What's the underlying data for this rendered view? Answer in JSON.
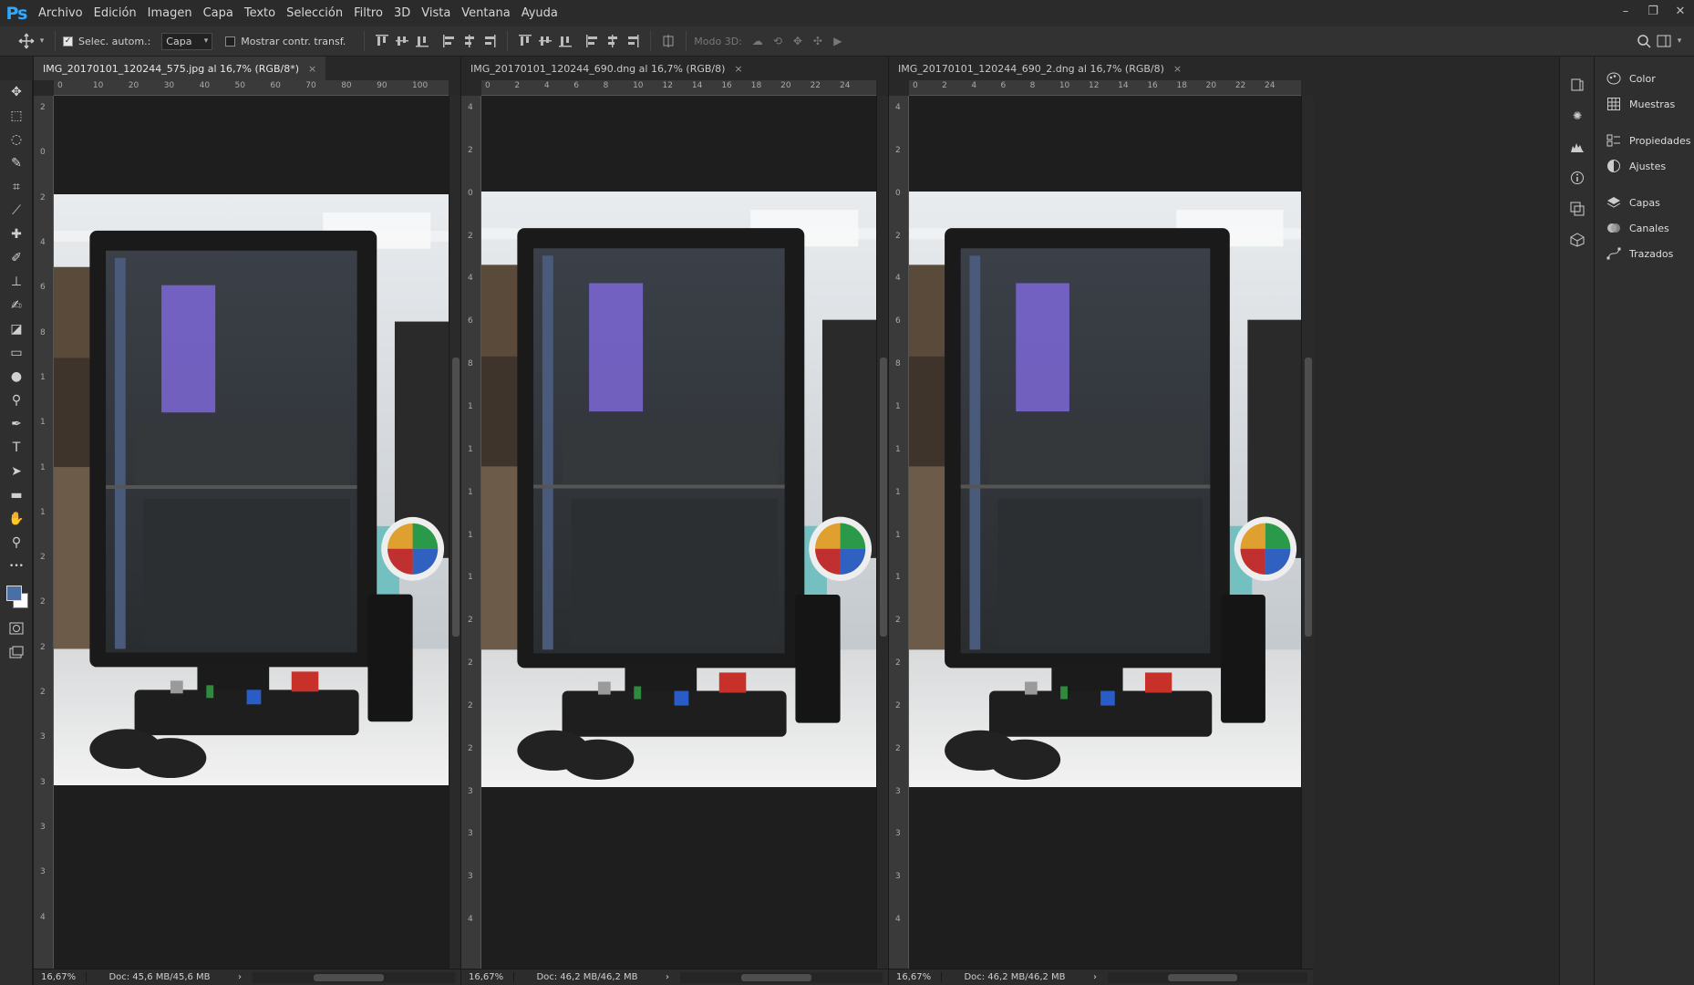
{
  "app": {
    "logo": "Ps"
  },
  "menu": [
    "Archivo",
    "Edición",
    "Imagen",
    "Capa",
    "Texto",
    "Selección",
    "Filtro",
    "3D",
    "Vista",
    "Ventana",
    "Ayuda"
  ],
  "window_controls": {
    "minimize": "–",
    "restore": "❐",
    "close": "✕"
  },
  "options": {
    "auto_select_label": "Selec. autom.:",
    "auto_select_checked": true,
    "auto_select_target": "Capa",
    "show_transform_label": "Mostrar contr. transf.",
    "show_transform_checked": false,
    "mode_3d_label": "Modo 3D:"
  },
  "tools": [
    "move-icon",
    "marquee-icon",
    "lasso-icon",
    "quick-select-icon",
    "crop-icon",
    "eyedropper-icon",
    "healing-brush-icon",
    "brush-icon",
    "clone-stamp-icon",
    "history-brush-icon",
    "eraser-icon",
    "gradient-icon",
    "blur-icon",
    "dodge-icon",
    "pen-icon",
    "type-icon",
    "path-select-icon",
    "rectangle-icon",
    "hand-icon",
    "zoom-icon",
    "more-tools-icon"
  ],
  "colors": {
    "foreground": "#4a6fa5",
    "background": "#ffffff",
    "accent": "#31a8ff"
  },
  "documents": [
    {
      "tab": "IMG_20170101_120244_575.jpg al 16,7% (RGB/8*)",
      "close": "×",
      "active": true,
      "zoom": "16,67%",
      "doc_info": "Doc: 45,6 MB/45,6 MB",
      "ruler_h": [
        "0",
        "10",
        "20",
        "30",
        "40",
        "50",
        "60",
        "70",
        "80",
        "90",
        "100"
      ],
      "ruler_v": [
        "2",
        "0",
        "2",
        "4",
        "6",
        "8",
        "1",
        "1",
        "1",
        "1",
        "2",
        "2",
        "2",
        "2",
        "3",
        "3",
        "3",
        "3",
        "4"
      ]
    },
    {
      "tab": "IMG_20170101_120244_690.dng al 16,7% (RGB/8)",
      "close": "×",
      "active": false,
      "zoom": "16,67%",
      "doc_info": "Doc: 46,2 MB/46,2 MB",
      "ruler_h": [
        "0",
        "2",
        "4",
        "6",
        "8",
        "10",
        "12",
        "14",
        "16",
        "18",
        "20",
        "22",
        "24"
      ],
      "ruler_v": [
        "4",
        "2",
        "0",
        "2",
        "4",
        "6",
        "8",
        "1",
        "1",
        "1",
        "1",
        "1",
        "2",
        "2",
        "2",
        "2",
        "3",
        "3",
        "3",
        "4"
      ]
    },
    {
      "tab": "IMG_20170101_120244_690_2.dng al 16,7% (RGB/8)",
      "close": "×",
      "active": false,
      "zoom": "16,67%",
      "doc_info": "Doc: 46,2 MB/46,2 MB",
      "ruler_h": [
        "0",
        "2",
        "4",
        "6",
        "8",
        "10",
        "12",
        "14",
        "16",
        "18",
        "20",
        "22",
        "24"
      ],
      "ruler_v": [
        "4",
        "2",
        "0",
        "2",
        "4",
        "6",
        "8",
        "1",
        "1",
        "1",
        "1",
        "1",
        "2",
        "2",
        "2",
        "2",
        "3",
        "3",
        "3",
        "4"
      ]
    }
  ],
  "panels": {
    "group1": [
      "Color",
      "Muestras"
    ],
    "group2": [
      "Propiedades",
      "Ajustes"
    ],
    "group3": [
      "Capas",
      "Canales",
      "Trazados"
    ]
  }
}
